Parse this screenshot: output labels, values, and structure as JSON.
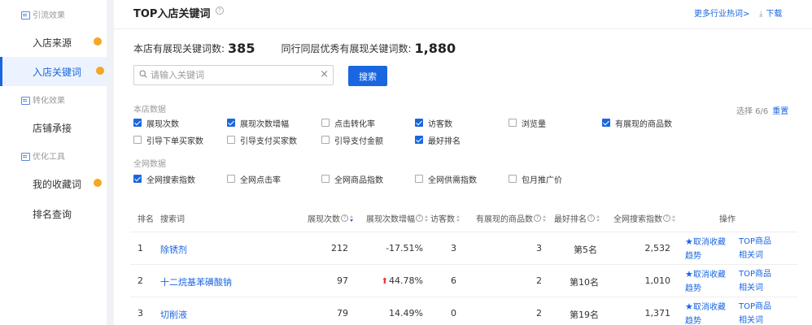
{
  "sidebar": {
    "groups": [
      {
        "label": "引流效果"
      },
      {
        "label": "转化效果"
      },
      {
        "label": "优化工具"
      }
    ],
    "items": [
      {
        "label": "入店来源"
      },
      {
        "label": "入店关键词"
      },
      {
        "label": "店铺承接"
      },
      {
        "label": "我的收藏词"
      },
      {
        "label": "排名查询"
      }
    ]
  },
  "header": {
    "title": "TOP入店关键词",
    "help": "?",
    "more_link": "更多行业热词>",
    "download_icon": "⤓",
    "download": "下载"
  },
  "stats": {
    "store_label": "本店有展现关键词数:",
    "store_value": "385",
    "peer_label": "同行同层优秀有展现关键词数:",
    "peer_value": "1,880"
  },
  "search": {
    "placeholder": "请输入关键词",
    "value": "",
    "clear": "×",
    "button": "搜索"
  },
  "filters": {
    "store_section": "本店数据",
    "global_section": "全网数据",
    "selected_info": "选择 6/6",
    "reset": "重置",
    "store_options": [
      {
        "label": "展现次数",
        "checked": true
      },
      {
        "label": "展现次数增幅",
        "checked": true
      },
      {
        "label": "点击转化率",
        "checked": false
      },
      {
        "label": "访客数",
        "checked": true
      },
      {
        "label": "浏览量",
        "checked": false
      },
      {
        "label": "有展现的商品数",
        "checked": true
      },
      {
        "label": "引导下单买家数",
        "checked": false
      },
      {
        "label": "引导支付买家数",
        "checked": false
      },
      {
        "label": "引导支付金额",
        "checked": false
      },
      {
        "label": "最好排名",
        "checked": true
      }
    ],
    "global_options": [
      {
        "label": "全网搜索指数",
        "checked": true
      },
      {
        "label": "全网点击率",
        "checked": false
      },
      {
        "label": "全网商品指数",
        "checked": false
      },
      {
        "label": "全网供需指数",
        "checked": false
      },
      {
        "label": "包月推广价",
        "checked": false
      }
    ]
  },
  "table": {
    "headers": {
      "rank": "排名",
      "keyword": "搜索词",
      "impressions": "展现次数",
      "growth": "展现次数增幅",
      "visitors": "访客数",
      "products": "有展现的商品数",
      "best_rank": "最好排名",
      "search_index": "全网搜索指数",
      "ops": "操作"
    },
    "rows": [
      {
        "rank": "1",
        "keyword": "除锈剂",
        "impressions": "212",
        "growth": "-17.51%",
        "growth_up": false,
        "visitors": "3",
        "products": "3",
        "best_rank": "第5名",
        "search_index": "2,532",
        "op_fav": "取消收藏",
        "op_trend": "趋势",
        "op_top": "TOP商品",
        "op_rel": "相关词"
      },
      {
        "rank": "2",
        "keyword": "十二烷基苯磺酸钠",
        "impressions": "97",
        "growth": "44.78%",
        "growth_up": true,
        "visitors": "6",
        "products": "2",
        "best_rank": "第10名",
        "search_index": "1,010",
        "op_fav": "取消收藏",
        "op_trend": "趋势",
        "op_top": "TOP商品",
        "op_rel": "相关词"
      },
      {
        "rank": "3",
        "keyword": "切削液",
        "impressions": "79",
        "growth": "14.49%",
        "growth_up": false,
        "visitors": "0",
        "products": "2",
        "best_rank": "第19名",
        "search_index": "1,371",
        "op_fav": "取消收藏",
        "op_trend": "趋势",
        "op_top": "TOP商品",
        "op_rel": "相关词"
      }
    ]
  },
  "icons": {
    "star": "★",
    "up_arrow": "⬆"
  },
  "colors": {
    "accent": "#1a66e0",
    "badge": "#f5a623",
    "up": "#e23b3b"
  }
}
